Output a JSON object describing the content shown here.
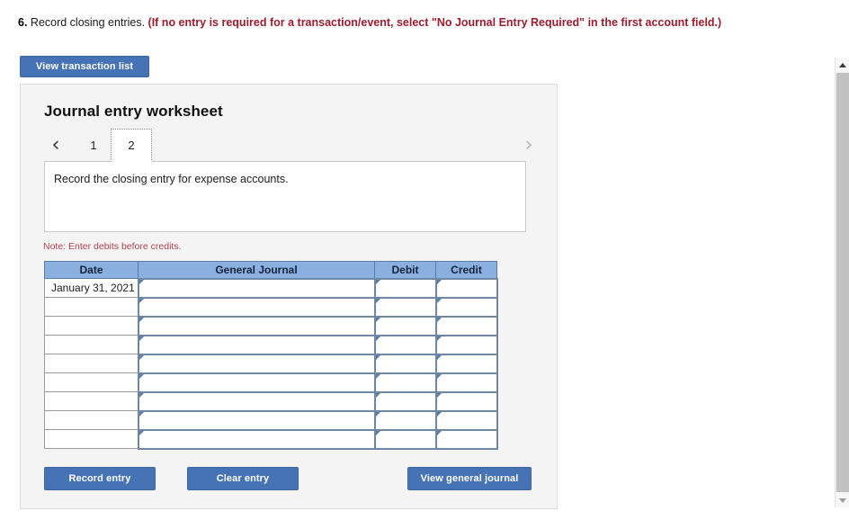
{
  "question": {
    "number": "6.",
    "text": " Record closing entries. ",
    "hint": "(If no entry is required for a transaction/event, select \"No Journal Entry Required\" in the first account field.)"
  },
  "toolbar": {
    "view_transaction_list_label": "View transaction list"
  },
  "panel": {
    "title": "Journal entry worksheet",
    "pager": {
      "prev_icon": "chevron-left-icon",
      "prev_glyph": "‹",
      "next_icon": "chevron-right-icon",
      "next_glyph": "›",
      "tabs": [
        {
          "label": "1",
          "active": false
        },
        {
          "label": "2",
          "active": true
        }
      ]
    },
    "description": "Record the closing entry for expense accounts.",
    "note": "Note: Enter debits before credits."
  },
  "table": {
    "headers": [
      "Date",
      "General Journal",
      "Debit",
      "Credit"
    ],
    "rows": [
      {
        "date": "January 31, 2021",
        "general_journal": "",
        "debit": "",
        "credit": ""
      },
      {
        "date": "",
        "general_journal": "",
        "debit": "",
        "credit": ""
      },
      {
        "date": "",
        "general_journal": "",
        "debit": "",
        "credit": ""
      },
      {
        "date": "",
        "general_journal": "",
        "debit": "",
        "credit": ""
      },
      {
        "date": "",
        "general_journal": "",
        "debit": "",
        "credit": ""
      },
      {
        "date": "",
        "general_journal": "",
        "debit": "",
        "credit": ""
      },
      {
        "date": "",
        "general_journal": "",
        "debit": "",
        "credit": ""
      },
      {
        "date": "",
        "general_journal": "",
        "debit": "",
        "credit": ""
      },
      {
        "date": "",
        "general_journal": "",
        "debit": "",
        "credit": ""
      }
    ]
  },
  "actions": {
    "record_entry_label": "Record entry",
    "clear_entry_label": "Clear entry",
    "view_general_journal_label": "View general journal"
  },
  "scrollbar": {
    "up_icon": "scroll-up-arrow-icon",
    "down_icon": "scroll-down-arrow-icon"
  },
  "colors": {
    "button_blue": "#4573b5",
    "table_header_blue": "#8ab0e0",
    "hint_red": "#9c1c2e",
    "note_red": "#b0424f",
    "panel_bg": "#f4f4f4",
    "input_border": "#6d87a5"
  }
}
